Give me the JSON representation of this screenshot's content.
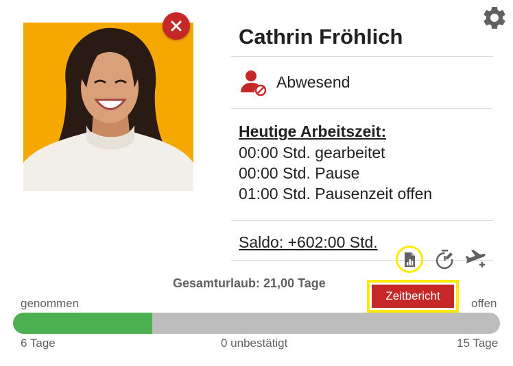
{
  "employee": {
    "name": "Cathrin Fröhlich",
    "status": "Abwesend"
  },
  "today": {
    "title": "Heutige Arbeitszeit:",
    "worked": "00:00 Std. gearbeitet",
    "pause": "00:00 Std. Pause",
    "pause_open": "01:00 Std. Pausenzeit offen"
  },
  "saldo": "Saldo: +602:00 Std.",
  "vacation": {
    "total": "Gesamturlaub: 21,00 Tage",
    "taken_label": "genommen",
    "open_label": "offen",
    "taken": "6 Tage",
    "unconfirmed": "0 unbestätigt",
    "remaining": "15 Tage",
    "taken_fraction": 0.2857
  },
  "buttons": {
    "zeitbericht": "Zeitbericht"
  },
  "icons": {
    "settings": "gear-icon",
    "close": "close-icon",
    "status": "user-blocked-icon",
    "report": "report-file-icon",
    "timer": "timer-edit-icon",
    "vacation": "airplane-add-icon"
  },
  "colors": {
    "accent_red": "#c62828",
    "progress_green": "#4caf50",
    "progress_track": "#bdbdbd",
    "highlight_yellow": "#ffeb00",
    "photo_bg": "#f5a800"
  }
}
